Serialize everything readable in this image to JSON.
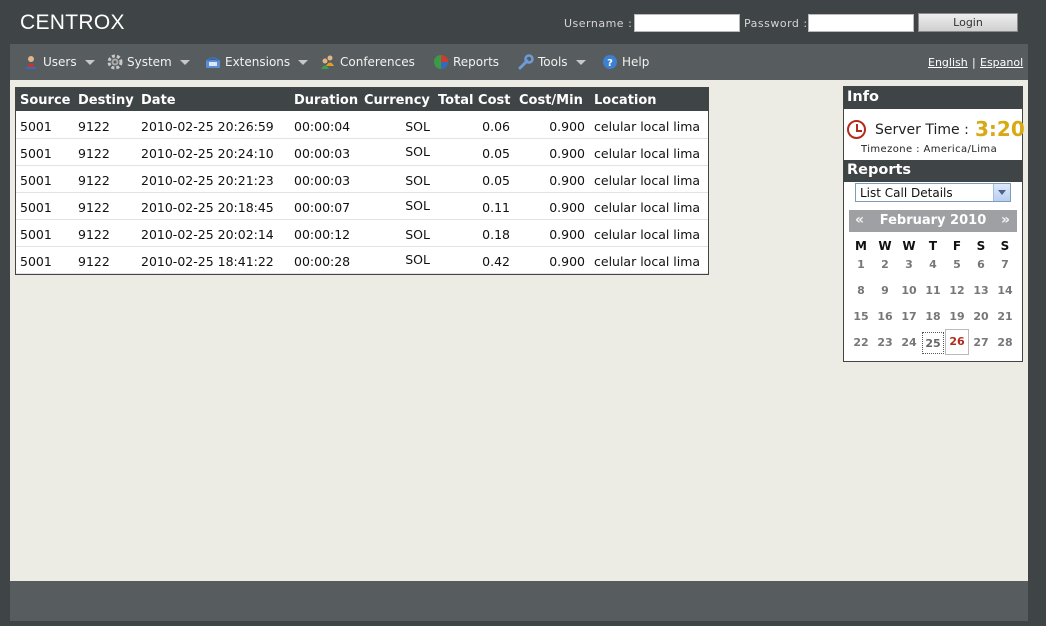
{
  "header": {
    "brand": "CENTROX",
    "username_label": "Username :",
    "password_label": "Password :",
    "username_value": "",
    "password_value": "",
    "login_button": "Login"
  },
  "menu": {
    "items": [
      {
        "label": "Users",
        "icon": "users-icon",
        "dropdown": true
      },
      {
        "label": "System",
        "icon": "gear-icon",
        "dropdown": true
      },
      {
        "label": "Extensions",
        "icon": "phone-icon",
        "dropdown": true
      },
      {
        "label": "Conferences",
        "icon": "conference-icon",
        "dropdown": false
      },
      {
        "label": "Reports",
        "icon": "pie-chart-icon",
        "dropdown": false
      },
      {
        "label": "Tools",
        "icon": "wrench-icon",
        "dropdown": true
      },
      {
        "label": "Help",
        "icon": "help-icon",
        "dropdown": false
      }
    ],
    "languages": [
      "English",
      "Espanol"
    ],
    "language_separator": "|"
  },
  "calls": {
    "columns": [
      "Source",
      "Destiny",
      "Date",
      "Duration",
      "Currency",
      "Total Cost",
      "Cost/Min",
      "Location"
    ],
    "rows": [
      [
        "5001",
        "9122",
        "2010-02-25 20:26:59",
        "00:00:04",
        "SOL",
        "0.06",
        "0.900",
        "celular local lima"
      ],
      [
        "5001",
        "9122",
        "2010-02-25 20:24:10",
        "00:00:03",
        "SOL",
        "0.05",
        "0.900",
        "celular local lima"
      ],
      [
        "5001",
        "9122",
        "2010-02-25 20:21:23",
        "00:00:03",
        "SOL",
        "0.05",
        "0.900",
        "celular local lima"
      ],
      [
        "5001",
        "9122",
        "2010-02-25 20:18:45",
        "00:00:07",
        "SOL",
        "0.11",
        "0.900",
        "celular local lima"
      ],
      [
        "5001",
        "9122",
        "2010-02-25 20:02:14",
        "00:00:12",
        "SOL",
        "0.18",
        "0.900",
        "celular local lima"
      ],
      [
        "5001",
        "9122",
        "2010-02-25 18:41:22",
        "00:00:28",
        "SOL",
        "0.42",
        "0.900",
        "celular local lima"
      ]
    ]
  },
  "info": {
    "title": "Info",
    "server_time_label": "Server Time :",
    "server_time": "3:20",
    "timezone": "Timezone : America/Lima"
  },
  "reports": {
    "title": "Reports",
    "selected": "List Call Details"
  },
  "calendar": {
    "prev": "«",
    "next": "»",
    "month_title": "February 2010",
    "weekdays": [
      "M",
      "W",
      "W",
      "T",
      "F",
      "S",
      "S"
    ],
    "weeks": [
      [
        "1",
        "2",
        "3",
        "4",
        "5",
        "6",
        "7"
      ],
      [
        "8",
        "9",
        "10",
        "11",
        "12",
        "13",
        "14"
      ],
      [
        "15",
        "16",
        "17",
        "18",
        "19",
        "20",
        "21"
      ],
      [
        "22",
        "23",
        "24",
        "25",
        "26",
        "27",
        "28"
      ]
    ],
    "selected_day": "25",
    "today": "26",
    "today_color": "#b22a1a"
  },
  "colors": {
    "header_bg": "#3f4446",
    "menu_bg": "#575c5e",
    "content_bg": "#ecece4",
    "server_time": "#d7a913"
  }
}
